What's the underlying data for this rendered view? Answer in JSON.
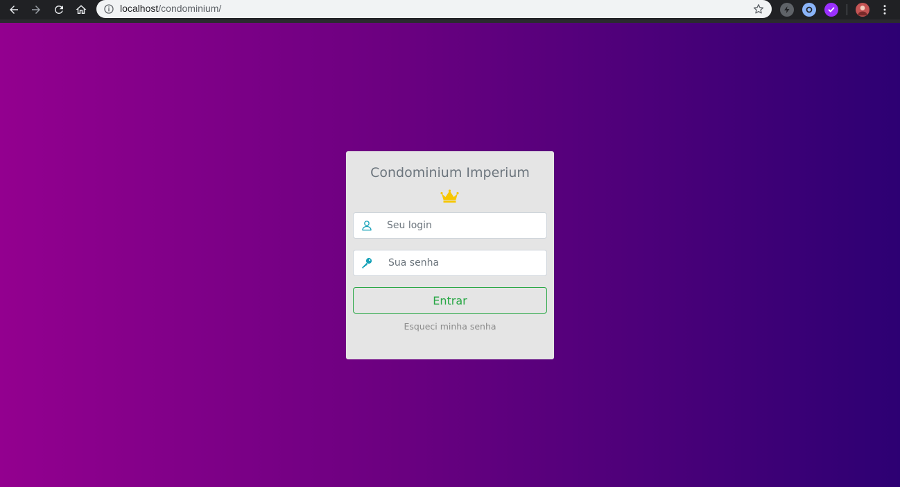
{
  "browser": {
    "url_host": "localhost",
    "url_path": "/condominium/"
  },
  "login": {
    "title": "Condominium Imperium",
    "login_placeholder": "Seu login",
    "password_placeholder": "Sua senha",
    "submit_label": "Entrar",
    "forgot_label": "Esqueci minha senha"
  },
  "colors": {
    "gradient_start": "#93008f",
    "gradient_end": "#2d0073",
    "card_bg": "#e5e5e5",
    "accent_green": "#28a745",
    "icon_teal": "#17a2b8",
    "crown_gold": "#f7c600"
  },
  "icons": {
    "back": "arrow-left-icon",
    "forward": "arrow-right-icon",
    "reload": "reload-icon",
    "home": "home-icon",
    "info": "info-icon",
    "bookmark": "star-icon",
    "crown": "crown-icon",
    "user": "user-icon",
    "key": "key-icon",
    "menu": "more-vert-icon"
  }
}
